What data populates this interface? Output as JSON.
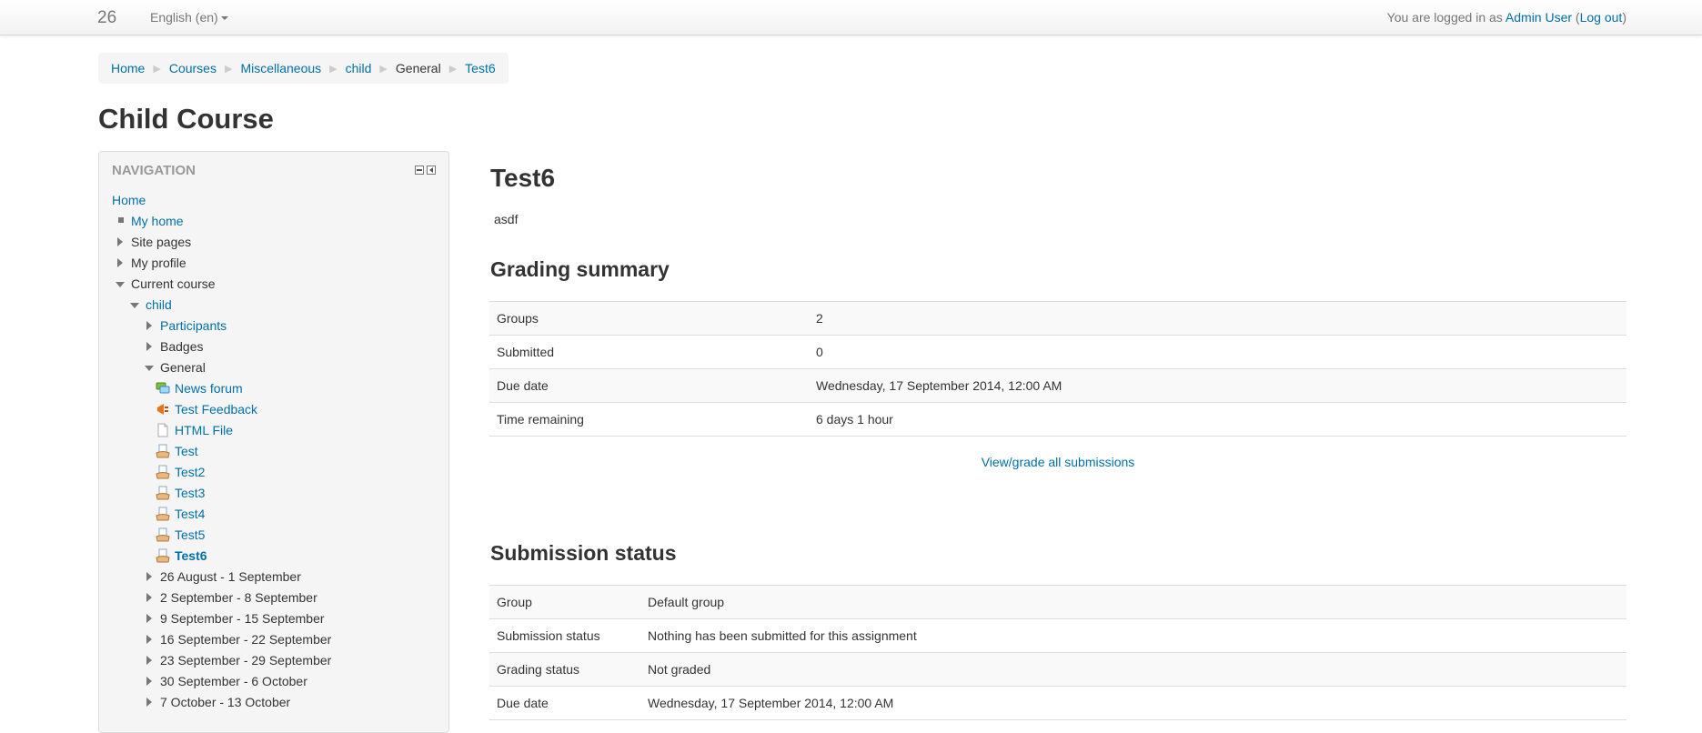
{
  "navbar": {
    "brand": "26",
    "language": "English (en)",
    "login_prefix": "You are logged in as ",
    "user_name": "Admin User",
    "logout_open": " (",
    "logout": "Log out",
    "logout_close": ")"
  },
  "breadcrumb": [
    "Home",
    "Courses",
    "Miscellaneous",
    "child",
    "General",
    "Test6"
  ],
  "course_title": "Child Course",
  "navigation": {
    "header": "Navigation",
    "items": [
      {
        "label": "Home"
      },
      {
        "label": "My home"
      },
      {
        "label": "Site pages"
      },
      {
        "label": "My profile"
      },
      {
        "label": "Current course"
      },
      {
        "label": "child"
      },
      {
        "label": "Participants"
      },
      {
        "label": "Badges"
      },
      {
        "label": "General"
      },
      {
        "label": "News forum",
        "icon": "forum-icon"
      },
      {
        "label": "Test Feedback",
        "icon": "feedback-icon"
      },
      {
        "label": "HTML File",
        "icon": "file-icon"
      },
      {
        "label": "Test",
        "icon": "assignment-icon"
      },
      {
        "label": "Test2",
        "icon": "assignment-icon"
      },
      {
        "label": "Test3",
        "icon": "assignment-icon"
      },
      {
        "label": "Test4",
        "icon": "assignment-icon"
      },
      {
        "label": "Test5",
        "icon": "assignment-icon"
      },
      {
        "label": "Test6",
        "icon": "assignment-icon"
      },
      {
        "label": "26 August - 1 September"
      },
      {
        "label": "2 September - 8 September"
      },
      {
        "label": "9 September - 15 September"
      },
      {
        "label": "16 September - 22 September"
      },
      {
        "label": "23 September - 29 September"
      },
      {
        "label": "30 September - 6 October"
      },
      {
        "label": "7 October - 13 October"
      }
    ]
  },
  "assignment": {
    "title": "Test6",
    "description": "asdf"
  },
  "grading_summary": {
    "title": "Grading summary",
    "rows": [
      {
        "label": "Groups",
        "value": "2"
      },
      {
        "label": "Submitted",
        "value": "0"
      },
      {
        "label": "Due date",
        "value": "Wednesday, 17 September 2014, 12:00 AM"
      },
      {
        "label": "Time remaining",
        "value": "6 days 1 hour"
      }
    ],
    "view_all_link": "View/grade all submissions"
  },
  "submission_status": {
    "title": "Submission status",
    "rows": [
      {
        "label": "Group",
        "value": "Default group"
      },
      {
        "label": "Submission status",
        "value": "Nothing has been submitted for this assignment"
      },
      {
        "label": "Grading status",
        "value": "Not graded"
      },
      {
        "label": "Due date",
        "value": "Wednesday, 17 September 2014, 12:00 AM"
      }
    ]
  },
  "colors": {
    "link": "#0070a8",
    "text": "#333333",
    "muted": "#777777"
  }
}
